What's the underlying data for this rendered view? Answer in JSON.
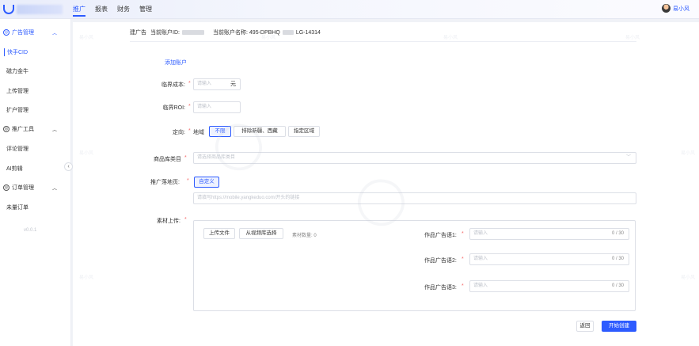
{
  "topbar": {
    "nav": [
      "推广",
      "报表",
      "财务",
      "管理"
    ],
    "active_nav": "推广",
    "user_name": "易小风"
  },
  "sidebar": {
    "group1": {
      "label": "广告管理",
      "icon": "ad-icon"
    },
    "group1_items": [
      "快手CID",
      "磁力金牛",
      "上传管理",
      "扩户管理"
    ],
    "group2": {
      "label": "推广工具",
      "icon": "tool-icon"
    },
    "group2_items": [
      "评论管理",
      "AI剪辑"
    ],
    "group3": {
      "label": "订单管理",
      "icon": "order-icon"
    },
    "group3_items": [
      "未量订单"
    ],
    "version": "v0.0.1"
  },
  "form": {
    "header_prefix": "建广告",
    "account_id_label": "当前账户ID:",
    "account_name_label": "当前账户名称:",
    "account_name_start": "495-DPBHQ",
    "account_name_end": "LG-14314",
    "add_account": "添加账户",
    "critical_cost": {
      "label": "临界成本:",
      "placeholder": "请输入",
      "suffix": "元"
    },
    "critical_roi": {
      "label": "临界ROI:",
      "placeholder": "请输入"
    },
    "targeting": {
      "label": "定向:",
      "sub_label": "地域",
      "options": [
        "不限",
        "排除新疆、西藏",
        "指定区域"
      ],
      "selected": "不限"
    },
    "product_category": {
      "label": "商品库类目",
      "placeholder": "请选择商品库类目"
    },
    "landing_page": {
      "label": "推广落地页:",
      "button": "自定义",
      "placeholder": "请填写https://mobile.yangkeduo.com/开头的链接"
    },
    "material": {
      "label": "素材上传:",
      "upload_file": "上传文件",
      "from_library": "从视频库选择",
      "count_label": "素材数量: 0",
      "ad_copy_labels": [
        "作品广告语1:",
        "作品广告语2:",
        "作品广告语3:"
      ],
      "ad_copy_placeholder": "请输入",
      "ad_copy_counter": "0 / 30"
    },
    "back_button": "返回",
    "create_button": "开始创建"
  },
  "watermark": {
    "text": "易小风"
  },
  "colors": {
    "primary": "#2d5bff",
    "required": "#f56c6c",
    "border": "#dcdfe6"
  }
}
